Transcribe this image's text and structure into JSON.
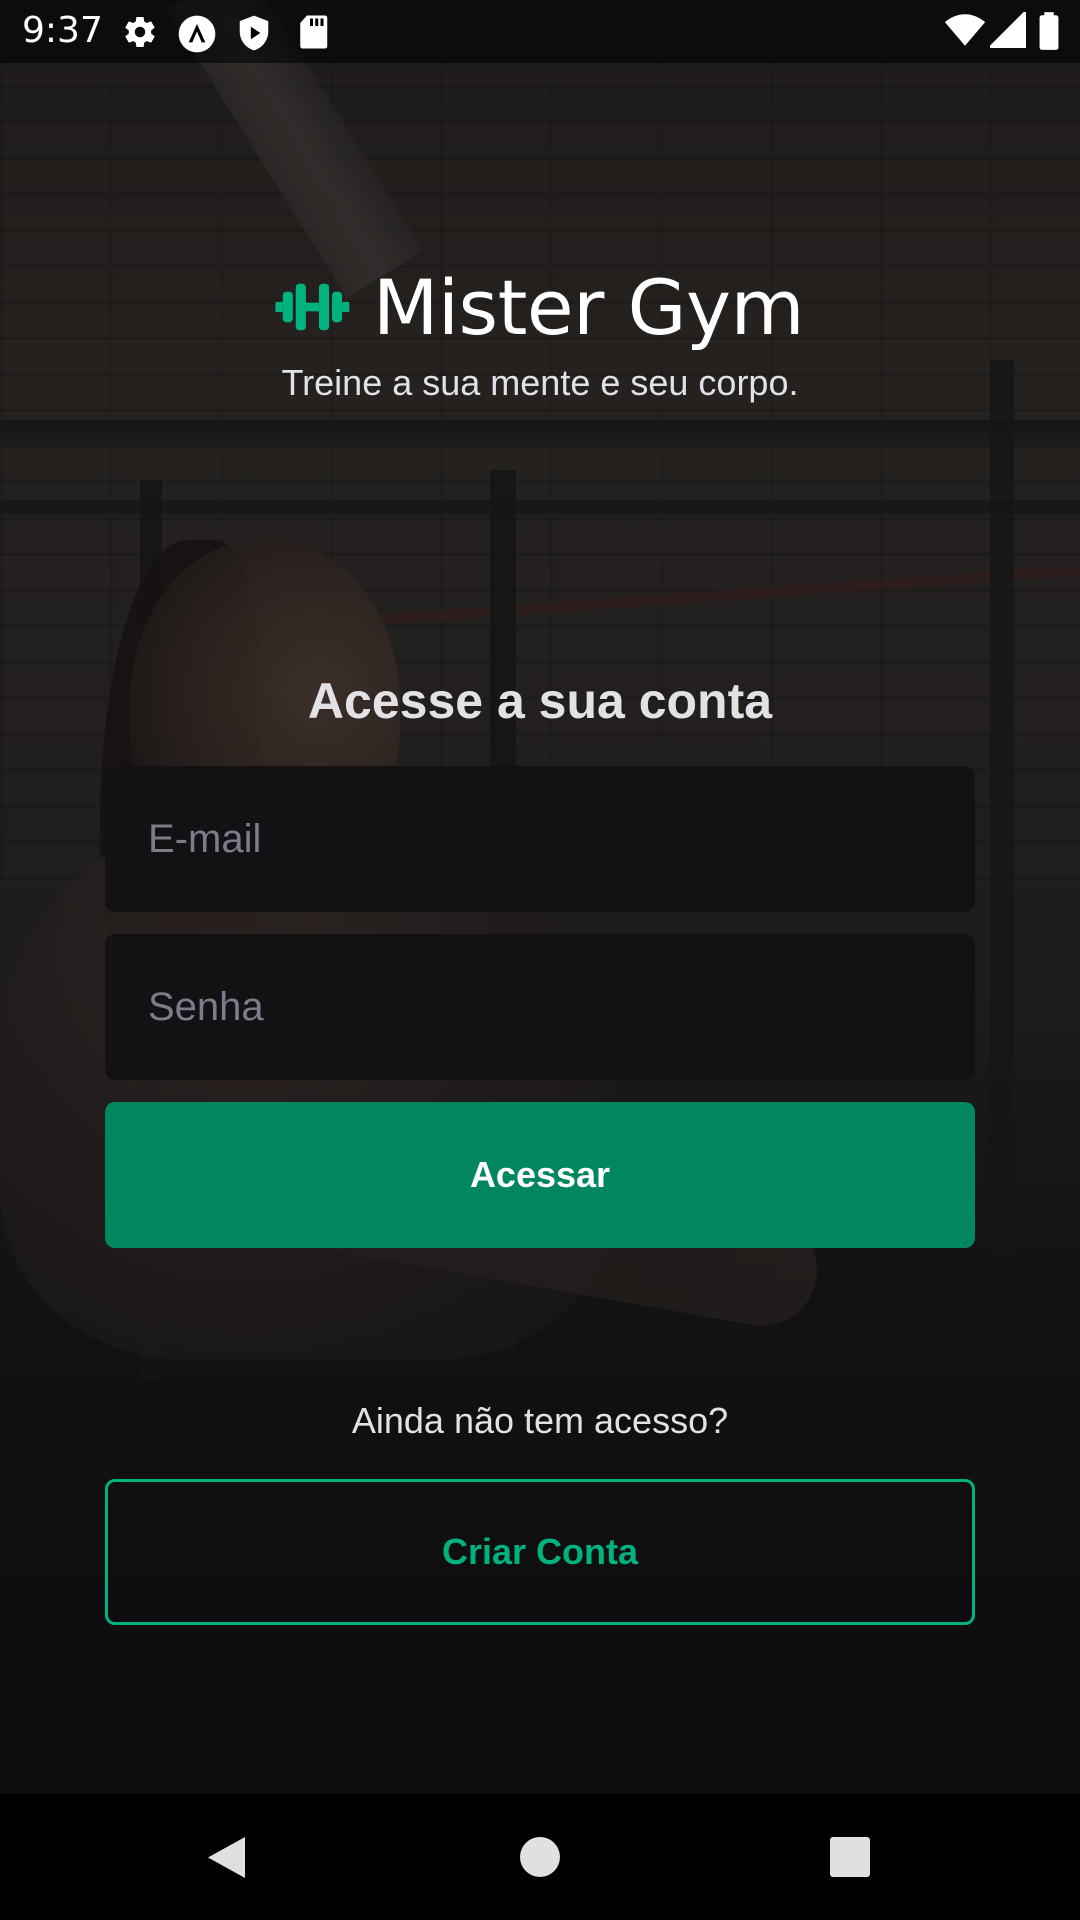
{
  "status_bar": {
    "time": "9:37",
    "icons": [
      "gear-icon",
      "a-badge-icon",
      "shield-play-icon",
      "sd-card-icon",
      "wifi-icon",
      "signal-icon",
      "battery-icon"
    ]
  },
  "brand": {
    "title": "Mister Gym",
    "tagline": "Treine a sua mente e seu corpo.",
    "icon": "dumbbell-icon",
    "accent_color": "#00B37E"
  },
  "login_form": {
    "heading": "Acesse a sua conta",
    "email_placeholder": "E-mail",
    "password_placeholder": "Senha",
    "submit_label": "Acessar"
  },
  "signup": {
    "prompt": "Ainda não tem acesso?",
    "button_label": "Criar Conta"
  },
  "nav_bar": {
    "buttons": [
      "back-icon",
      "home-icon",
      "recents-icon"
    ]
  },
  "colors": {
    "background": "#121214",
    "primary_button": "#00875F",
    "input_background": "#121214",
    "placeholder": "#7C7C8A",
    "text": "#E1E1E6"
  }
}
